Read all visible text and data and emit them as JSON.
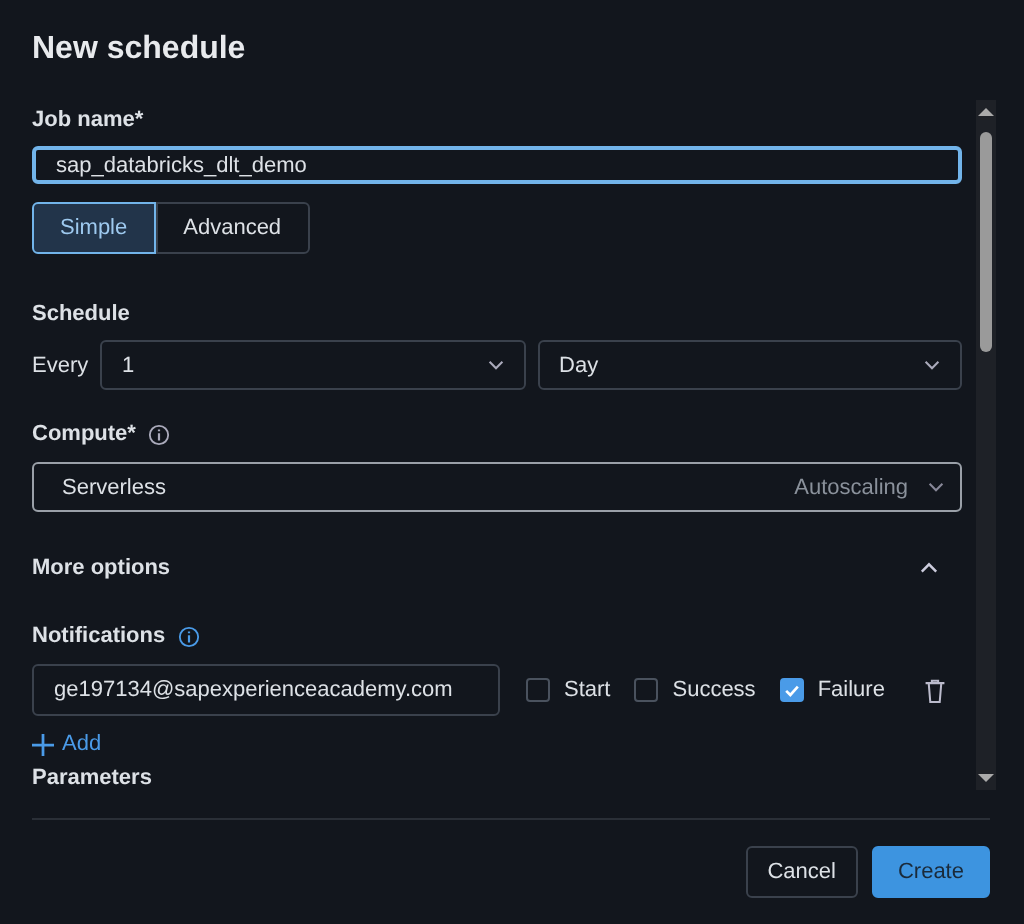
{
  "dialog": {
    "title": "New schedule"
  },
  "job_name": {
    "label": "Job name*",
    "value": "sap_databricks_dlt_demo"
  },
  "mode_tabs": [
    {
      "label": "Simple",
      "selected": true
    },
    {
      "label": "Advanced",
      "selected": false
    }
  ],
  "schedule": {
    "label": "Schedule",
    "prefix": "Every",
    "interval": "1",
    "unit": "Day"
  },
  "compute": {
    "label": "Compute*",
    "value": "Serverless",
    "hint": "Autoscaling"
  },
  "more_options": {
    "label": "More options",
    "expanded": true
  },
  "notifications": {
    "label": "Notifications",
    "email": "ge197134@sapexperienceacademy.com",
    "events": [
      {
        "label": "Start",
        "checked": false
      },
      {
        "label": "Success",
        "checked": false
      },
      {
        "label": "Failure",
        "checked": true
      }
    ],
    "add_label": "Add"
  },
  "parameters": {
    "label": "Parameters"
  },
  "buttons": [
    {
      "label": "Cancel",
      "kind": "secondary"
    },
    {
      "label": "Create",
      "kind": "primary"
    }
  ]
}
